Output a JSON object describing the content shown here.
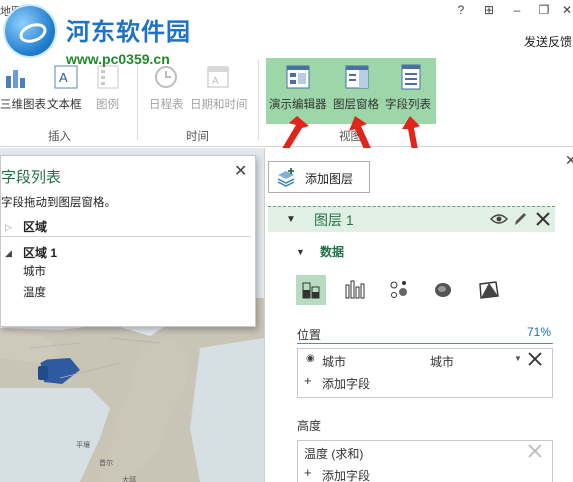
{
  "window": {
    "title": "地图",
    "help": "?",
    "restore_down_icon": "⊞",
    "minimize": "–",
    "maximize": "❐",
    "close": "✕",
    "feedback": "发送反馈"
  },
  "watermark": {
    "name": "河东软件园",
    "url": "www.pc0359.cn"
  },
  "ribbon": {
    "insert_group": {
      "label": "插入",
      "buttons": [
        "三维图表",
        "文本框",
        "图例"
      ]
    },
    "time_group": {
      "label": "时间",
      "buttons": [
        "日程表",
        "日期和时间"
      ]
    },
    "view_group": {
      "label": "视图",
      "buttons": [
        "演示编辑器",
        "图层窗格",
        "字段列表"
      ]
    }
  },
  "field_list": {
    "title": "字段列表",
    "hint": "字段拖动到图层窗格。",
    "close": "✕",
    "section": "区域",
    "region_name": "区域 1",
    "fields": [
      "城市",
      "温度"
    ]
  },
  "layer_pane": {
    "add_layer": "添加图层",
    "close": "✕",
    "layer_name": "图层 1",
    "data_label": "数据",
    "location_label": "位置",
    "percent": "71%",
    "location_field": "城市",
    "location_type": "城市",
    "add_field": "添加字段",
    "height_label": "高度",
    "height_field": "温度 (求和)",
    "height_add_field": "添加字段"
  },
  "map": {
    "labels": [
      "平壤",
      "首尔",
      "大邱"
    ]
  },
  "colors": {
    "accent_green": "#217346",
    "highlight": "#9cd6a9",
    "arrow_red": "#e0261b",
    "link_blue": "#1f6fb8"
  }
}
